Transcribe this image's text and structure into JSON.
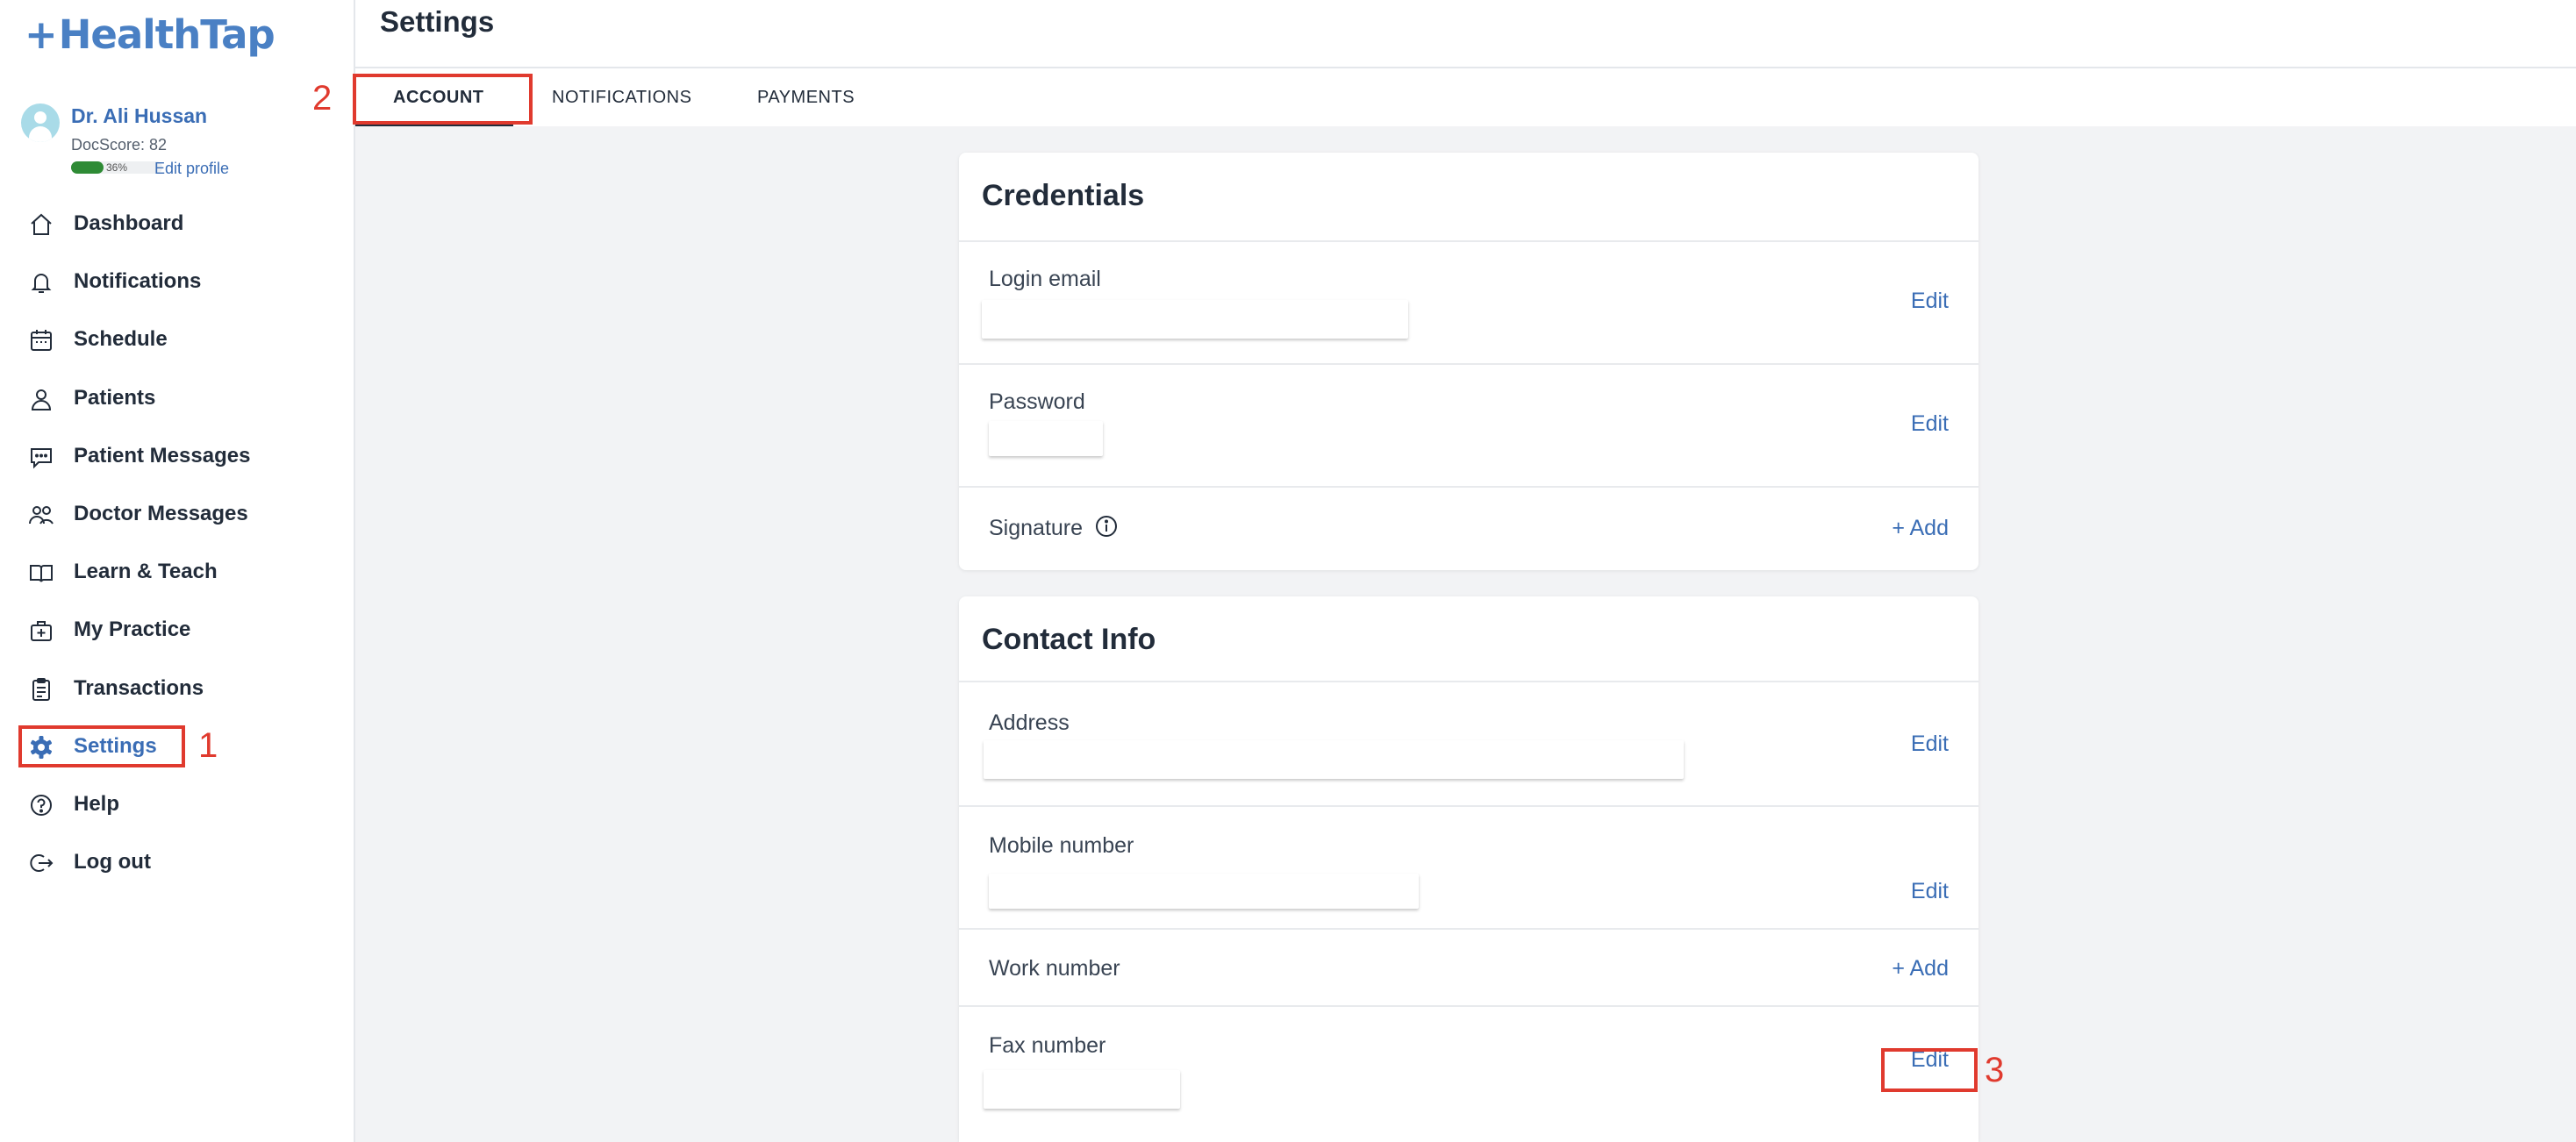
{
  "brand": {
    "name": "HealthTap",
    "color": "#4a80c4"
  },
  "profile": {
    "name": "Dr. Ali Hussan",
    "docscore": "DocScore: 82",
    "progress_text": "36%",
    "progress_value": 0.36,
    "edit_label": "Edit profile"
  },
  "sidebar": {
    "items": [
      {
        "label": "Dashboard",
        "icon": "home-icon"
      },
      {
        "label": "Notifications",
        "icon": "bell-icon"
      },
      {
        "label": "Schedule",
        "icon": "calendar-icon"
      },
      {
        "label": "Patients",
        "icon": "person-icon"
      },
      {
        "label": "Patient Messages",
        "icon": "chat-icon"
      },
      {
        "label": "Doctor Messages",
        "icon": "group-icon"
      },
      {
        "label": "Learn & Teach",
        "icon": "book-icon"
      },
      {
        "label": "My Practice",
        "icon": "medical-kit-icon"
      },
      {
        "label": "Transactions",
        "icon": "clipboard-icon"
      },
      {
        "label": "Settings",
        "icon": "gear-icon",
        "active": true
      },
      {
        "label": "Help",
        "icon": "help-icon"
      },
      {
        "label": "Log out",
        "icon": "logout-icon"
      }
    ]
  },
  "header": {
    "title": "Settings"
  },
  "tabs": [
    {
      "label": "ACCOUNT",
      "active": true
    },
    {
      "label": "NOTIFICATIONS"
    },
    {
      "label": "PAYMENTS"
    }
  ],
  "credentials": {
    "title": "Credentials",
    "login_email": {
      "label": "Login email",
      "action": "Edit"
    },
    "password": {
      "label": "Password",
      "action": "Edit"
    },
    "signature": {
      "label": "Signature",
      "action": "+ Add",
      "icon": "info-icon"
    }
  },
  "contact": {
    "title": "Contact Info",
    "address": {
      "label": "Address",
      "action": "Edit"
    },
    "mobile": {
      "label": "Mobile number",
      "action": "Edit"
    },
    "work": {
      "label": "Work number",
      "action": "+ Add"
    },
    "fax": {
      "label": "Fax number",
      "action": "Edit"
    }
  },
  "annotations": {
    "one": "1",
    "two": "2",
    "three": "3",
    "color": "#e03a2e"
  },
  "colors": {
    "accent": "#3a6db5",
    "background": "#f2f3f5",
    "progress": "#2e8b35"
  }
}
